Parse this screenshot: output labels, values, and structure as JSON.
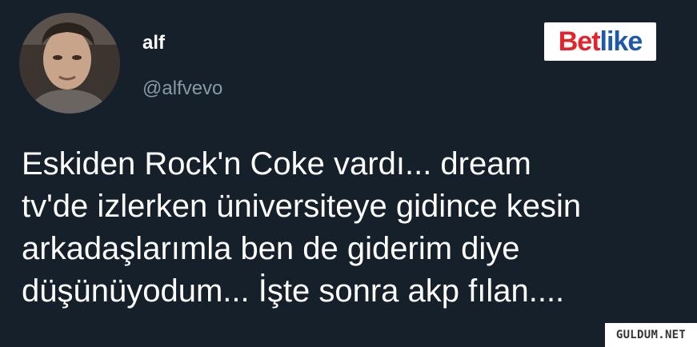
{
  "tweet": {
    "display_name": "alf",
    "handle": "@alfvevo",
    "text_lines": [
      "Eskiden Rock'n Coke vardı... dream",
      "tv'de izlerken üniversiteye gidince kesin",
      "arkadaşlarımla ben de giderim diye",
      "düşünüyodum... İşte sonra akp fılan...."
    ]
  },
  "brand_logo": {
    "text": "Betlike",
    "text_red": "Bet",
    "text_blue": "like"
  },
  "watermark": {
    "text": "GULDUM.NET"
  },
  "colors": {
    "background": "#15202b",
    "display_name": "#ffffff",
    "handle": "#8899a6",
    "body_text": "#ffffff",
    "brand_red": "#e5232a",
    "brand_blue": "#1e58a8"
  }
}
